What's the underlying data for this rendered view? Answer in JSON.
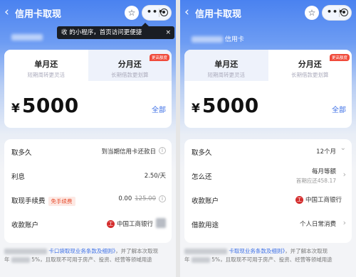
{
  "left": {
    "nav": {
      "back": "‹",
      "title": "信用卡取现",
      "star": "☆",
      "more": "•••"
    },
    "tooltip": {
      "text": "收 的小程序，首页访问更便捷",
      "close": "×"
    },
    "tabs": [
      {
        "title": "单月还",
        "sub": "短期周转更灵活",
        "active": true
      },
      {
        "title": "分月还",
        "sub": "长期借款更划算",
        "badge": "更高额度",
        "active": false
      }
    ],
    "amount": {
      "currency": "¥",
      "value": "5000",
      "all": "全部"
    },
    "rows": [
      {
        "label": "取多久",
        "value": "到当期信用卡还款日",
        "indicator": "i"
      },
      {
        "label": "利息",
        "value": "2.50/天"
      },
      {
        "label": "取现手续费",
        "tag": "免手续费",
        "value": "0.00",
        "strike": "125.00",
        "indicator": "i"
      },
      {
        "label": "收款账户",
        "bank": "中国工商银行"
      }
    ],
    "footer": {
      "link": "卡口袋取现业务条款及细则》",
      "tail1": "，并了解本次取现",
      "line2_prefix": "年",
      "line2": "5%，且取现不可用于房产、投资、经营等领域用途"
    }
  },
  "right": {
    "nav": {
      "back": "‹",
      "title": "信用卡取现",
      "star": "☆",
      "more": "•••"
    },
    "card_label": "信用卡",
    "tabs": [
      {
        "title": "单月还",
        "sub": "短期周转更灵活",
        "active": false
      },
      {
        "title": "分月还",
        "sub": "长期借款更划算",
        "badge": "更高额度",
        "active": true
      }
    ],
    "amount": {
      "currency": "¥",
      "value": "5000",
      "all": "全部"
    },
    "rows": [
      {
        "label": "取多久",
        "value": "12个月",
        "indicator": "⌄"
      },
      {
        "label": "怎么还",
        "value": "每月等额",
        "sub": "首期应还458.17",
        "indicator": "›"
      },
      {
        "label": "收款账户",
        "bank": "中国工商银行"
      },
      {
        "label": "借款用途",
        "value": "个人日常消费",
        "indicator": "›"
      }
    ],
    "footer": {
      "link": "卡取现业务条款及细则》",
      "tail1": "，并了解本次取现",
      "line2_prefix": "年",
      "line2": "5%，且取现不可用于房产、投资、经营等领域用途"
    }
  },
  "colors": {
    "accent": "#3c6fe6",
    "badge": "#f04a3a",
    "bank": "#d42d2d",
    "header": "#4a82f0"
  }
}
